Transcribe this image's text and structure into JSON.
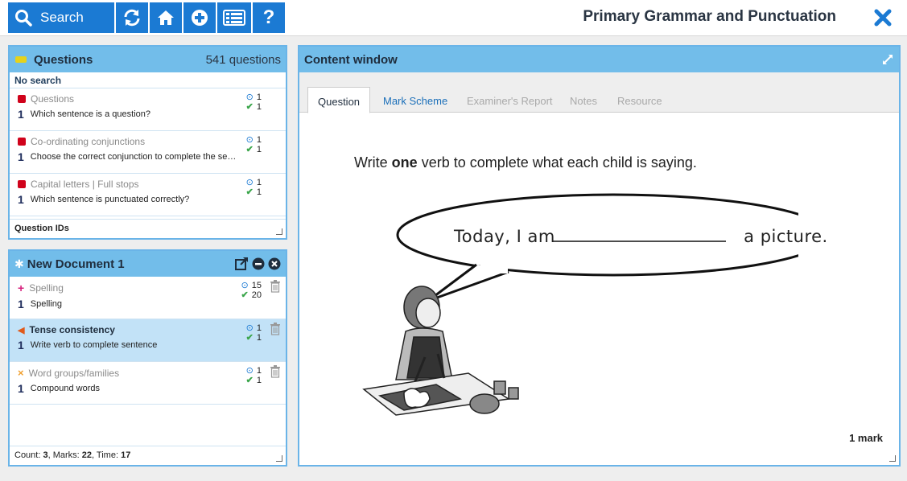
{
  "toolbar": {
    "search_label": "Search",
    "buttons": [
      "refresh-icon",
      "home-icon",
      "add-icon",
      "list-icon",
      "help-icon"
    ],
    "help_glyph": "?"
  },
  "app_title": "Primary Grammar and Punctuation",
  "questions_panel": {
    "title": "Questions",
    "count": "541 questions",
    "search_state": "No search",
    "items": [
      {
        "topic": "Questions",
        "number": "1",
        "text": "Which sentence is a question?",
        "time": "1",
        "marks": "1"
      },
      {
        "topic": "Co-ordinating conjunctions",
        "number": "1",
        "text": "Choose the correct conjunction to complete the se…",
        "time": "1",
        "marks": "1"
      },
      {
        "topic": "Capital letters | Full stops",
        "number": "1",
        "text": "Which sentence is punctuated correctly?",
        "time": "1",
        "marks": "1"
      }
    ],
    "footer": "Question IDs"
  },
  "document_panel": {
    "title": "New Document 1",
    "items": [
      {
        "topic": "Spelling",
        "number": "1",
        "text": "Spelling",
        "time": "15",
        "marks": "20"
      },
      {
        "topic": "Tense consistency",
        "number": "1",
        "text": "Write verb to complete sentence",
        "time": "1",
        "marks": "1"
      },
      {
        "topic": "Word groups/families",
        "number": "1",
        "text": "Compound words",
        "time": "1",
        "marks": "1"
      }
    ],
    "footer": {
      "count_label": "Count: ",
      "count": "3",
      "marks_label": ", Marks: ",
      "marks": "22",
      "time_label": ", Time: ",
      "time": "17"
    }
  },
  "content_window": {
    "title": "Content window",
    "tabs": [
      "Question",
      "Mark Scheme",
      "Examiner's Report",
      "Notes",
      "Resource"
    ],
    "question_pre": "Write ",
    "question_bold": "one",
    "question_post": " verb to complete what each child is saying.",
    "speech_pre": "Today, I am",
    "speech_post": "a picture.",
    "mark": "1 mark"
  },
  "colors": {
    "toolbar_blue": "#1b7ad3",
    "panel_head": "#72bdea",
    "selected_row": "#c2e2f7"
  }
}
